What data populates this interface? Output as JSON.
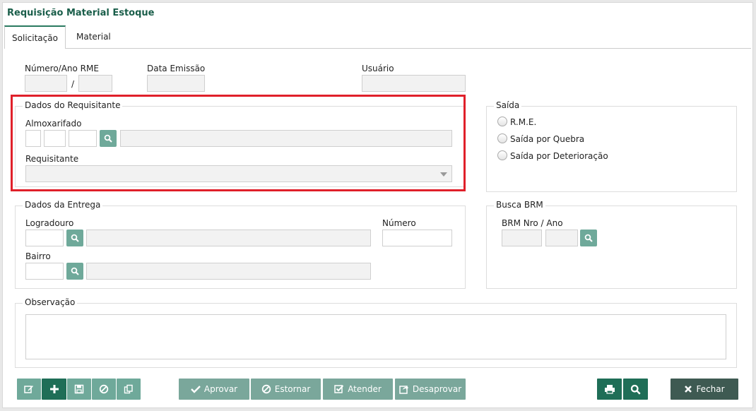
{
  "window": {
    "title": "Requisição Material Estoque"
  },
  "tabs": [
    {
      "label": "Solicitação"
    },
    {
      "label": "Material"
    }
  ],
  "header": {
    "numero_ano_label": "Número/Ano RME",
    "separator": "/",
    "data_emissao_label": "Data Emissão",
    "usuario_label": "Usuário"
  },
  "requisitante": {
    "legend": "Dados do Requisitante",
    "almoxarifado_label": "Almoxarifado",
    "requisitante_label": "Requisitante"
  },
  "saida": {
    "legend": "Saída",
    "options": [
      {
        "label": "R.M.E."
      },
      {
        "label": "Saída por Quebra"
      },
      {
        "label": "Saída por Deterioração"
      }
    ]
  },
  "entrega": {
    "legend": "Dados da Entrega",
    "logradouro_label": "Logradouro",
    "numero_label": "Número",
    "bairro_label": "Bairro"
  },
  "busca_brm": {
    "legend": "Busca BRM",
    "nro_ano_label": "BRM Nro / Ano"
  },
  "observacao": {
    "legend": "Observação"
  },
  "toolbar": {
    "aprovar": "Aprovar",
    "estornar": "Estornar",
    "atender": "Atender",
    "desaprovar": "Desaprovar",
    "fechar": "Fechar"
  },
  "icons": {
    "edit": "edit-icon",
    "add": "plus-icon",
    "save": "save-icon",
    "cancel": "ban-icon",
    "copy": "copy-icon",
    "search": "search-icon",
    "print": "print-icon",
    "check": "check-icon",
    "close": "close-icon"
  },
  "colors": {
    "accent": "#1f6e57",
    "button_light": "#6fa99a",
    "highlight": "#e0202a",
    "title": "#1a5e4a"
  }
}
